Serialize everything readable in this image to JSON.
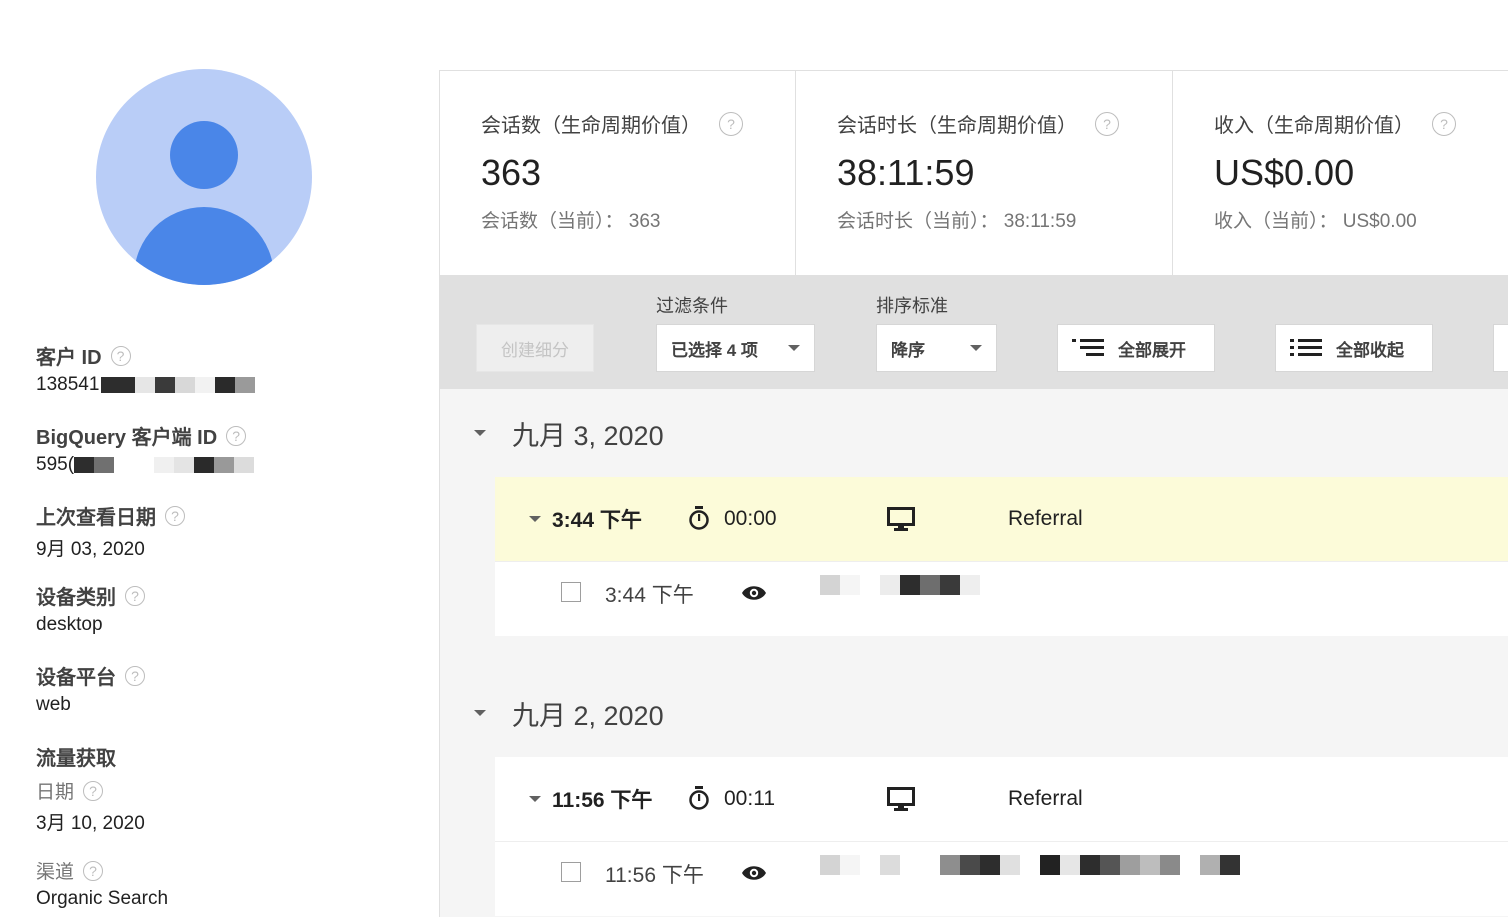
{
  "sidebar": {
    "client_id": {
      "label": "客户 ID",
      "value": "138541"
    },
    "bigquery_id": {
      "label": "BigQuery 客户端 ID",
      "value": "595("
    },
    "last_seen": {
      "label": "上次查看日期",
      "value": "9月 03, 2020"
    },
    "device_category": {
      "label": "设备类别",
      "value": "desktop"
    },
    "device_platform": {
      "label": "设备平台",
      "value": "web"
    },
    "acquisition": {
      "label": "流量获取",
      "date_label": "日期",
      "date_value": "3月 10, 2020",
      "channel_label": "渠道",
      "channel_value": "Organic Search"
    }
  },
  "metrics": [
    {
      "label": "会话数（生命周期价值）",
      "value": "363",
      "sub": "会话数（当前）： 363"
    },
    {
      "label": "会话时长（生命周期价值）",
      "value": "38:11:59",
      "sub": "会话时长（当前）： 38:11:59"
    },
    {
      "label": "收入（生命周期价值）",
      "value": "US$0.00",
      "sub": "收入（当前）： US$0.00"
    }
  ],
  "toolbar": {
    "create_segment": "创建细分",
    "filter_label": "过滤条件",
    "filter_value": "已选择 4 项",
    "sort_label": "排序标准",
    "sort_value": "降序",
    "expand_all": "全部展开",
    "collapse_all": "全部收起"
  },
  "days": [
    {
      "date": "九月 3, 2020",
      "session": {
        "time": "3:44 下午",
        "duration": "00:00",
        "channel": "Referral",
        "hit_time": "3:44 下午"
      }
    },
    {
      "date": "九月 2, 2020",
      "session": {
        "time": "11:56 下午",
        "duration": "00:11",
        "channel": "Referral",
        "hit_time": "11:56 下午"
      }
    }
  ],
  "icons": {
    "help": "help-circle-icon",
    "timer": "stopwatch-icon",
    "device": "desktop-monitor-icon",
    "pageview": "eye-icon"
  },
  "colors": {
    "avatar_bg": "#b9cdf7",
    "avatar_fg": "#4a86e8",
    "active_row": "#fcfbd9",
    "toolbar_bg": "#e0e0e0"
  }
}
